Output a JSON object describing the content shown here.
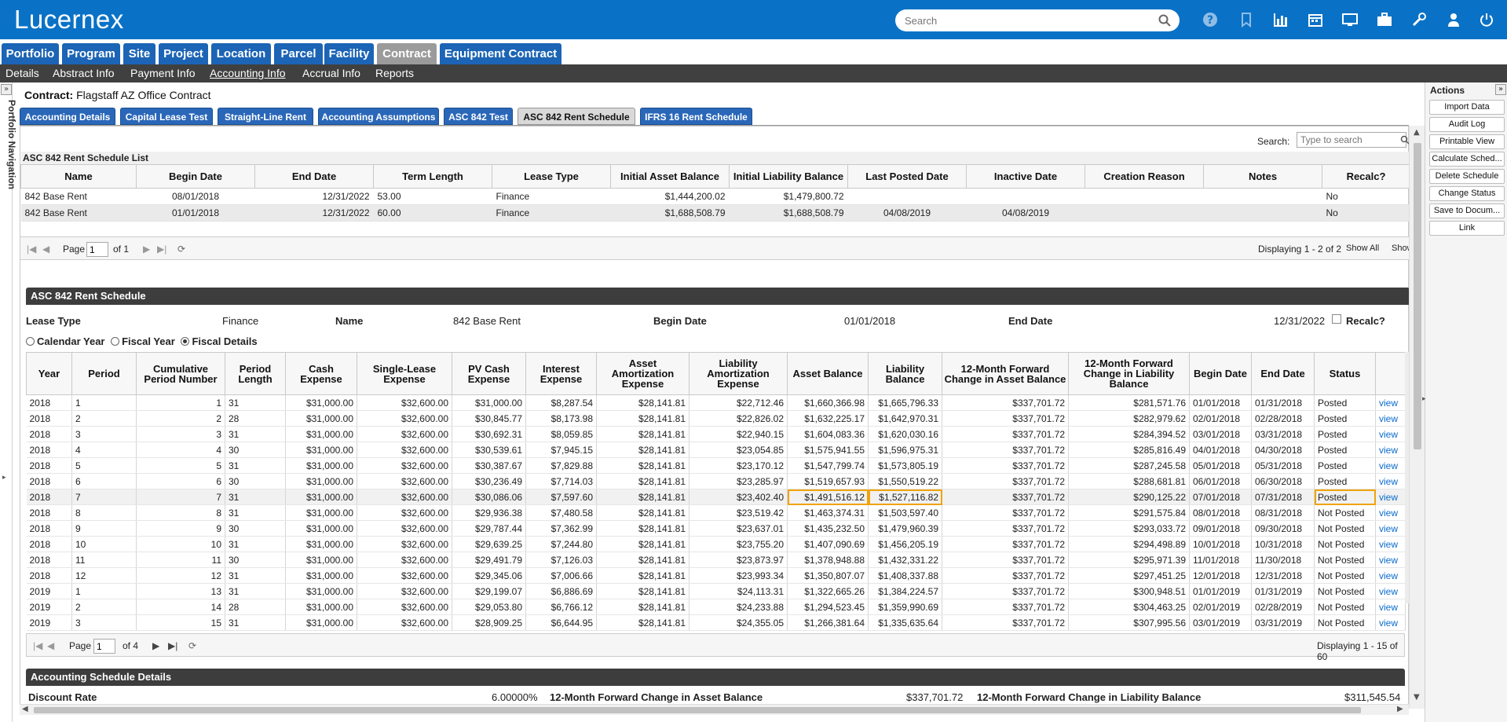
{
  "app": {
    "logo": "Lucernex"
  },
  "header": {
    "search_placeholder": "Search",
    "icons": [
      "search-icon",
      "help-icon",
      "bookmark-icon",
      "chart-icon",
      "calendar-icon",
      "monitor-icon",
      "briefcase-icon",
      "wrench-icon",
      "user-icon",
      "power-icon"
    ]
  },
  "main_tabs": [
    {
      "label": "Portfolio"
    },
    {
      "label": "Program"
    },
    {
      "label": "Site"
    },
    {
      "label": "Project"
    },
    {
      "label": "Location"
    },
    {
      "label": "Parcel"
    },
    {
      "label": "Facility"
    },
    {
      "label": "Contract"
    },
    {
      "label": "Equipment Contract"
    }
  ],
  "sub_nav": [
    {
      "label": "Details"
    },
    {
      "label": "Abstract Info"
    },
    {
      "label": "Payment Info"
    },
    {
      "label": "Accounting Info"
    },
    {
      "label": "Accrual Info"
    },
    {
      "label": "Reports"
    }
  ],
  "left_nav": {
    "label": "Portfolio Navigation",
    "toggle": "»"
  },
  "actions": {
    "title": "Actions",
    "toggle": "»",
    "buttons": [
      "Import Data",
      "Audit Log",
      "Printable View",
      "Calculate Sched...",
      "Delete Schedule",
      "Change Status",
      "Save to Docum...",
      "Link"
    ]
  },
  "contract": {
    "label": "Contract:",
    "name": "Flagstaff AZ Office Contract"
  },
  "contract_tabs": [
    {
      "label": "Accounting Details"
    },
    {
      "label": "Capital Lease Test"
    },
    {
      "label": "Straight-Line Rent"
    },
    {
      "label": "Accounting Assumptions"
    },
    {
      "label": "ASC 842 Test"
    },
    {
      "label": "ASC 842 Rent Schedule"
    },
    {
      "label": "IFRS 16 Rent Schedule"
    }
  ],
  "list": {
    "search_label": "Search:",
    "search_placeholder": "Type to search",
    "title": "ASC 842 Rent Schedule List",
    "columns": [
      "Name",
      "Begin Date",
      "End Date",
      "Term Length",
      "Lease Type",
      "Initial Asset Balance",
      "Initial Liability Balance",
      "Last Posted Date",
      "Inactive Date",
      "Creation Reason",
      "Notes",
      "Recalc?"
    ],
    "rows": [
      [
        "842 Base Rent",
        "08/01/2018",
        "12/31/2022",
        "53.00",
        "Finance",
        "$1,444,200.02",
        "$1,479,800.72",
        "",
        "",
        "",
        "",
        "No"
      ],
      [
        "842 Base Rent",
        "01/01/2018",
        "12/31/2022",
        "60.00",
        "Finance",
        "$1,688,508.79",
        "$1,688,508.79",
        "04/08/2019",
        "04/08/2019",
        "",
        "",
        "No"
      ]
    ],
    "pager": {
      "page_label": "Page",
      "page_value": "1",
      "of": "of 1",
      "displaying": "Displaying 1 - 2 of 2",
      "show_all": "Show All",
      "show": "Show"
    }
  },
  "schedule": {
    "title": "ASC 842 Rent Schedule",
    "lease_type_label": "Lease Type",
    "lease_type": "Finance",
    "name_label": "Name",
    "name": "842 Base Rent",
    "begin_label": "Begin Date",
    "begin": "01/01/2018",
    "end_label": "End Date",
    "end": "12/31/2022",
    "recalc_label": "Recalc?",
    "radio_calendar": "Calendar Year",
    "radio_fiscal": "Fiscal Year",
    "radio_details": "Fiscal Details",
    "columns": [
      "Year",
      "Period",
      "Cumulative Period Number",
      "Period Length",
      "Cash Expense",
      "Single-Lease Expense",
      "PV Cash Expense",
      "Interest Expense",
      "Asset Amortization Expense",
      "Liability Amortization Expense",
      "Asset Balance",
      "Liability Balance",
      "12-Month Forward Change in Asset Balance",
      "12-Month Forward Change in Liability Balance",
      "Begin Date",
      "End Date",
      "Status",
      ""
    ],
    "rows": [
      [
        "2018",
        "1",
        "1",
        "31",
        "$31,000.00",
        "$32,600.00",
        "$31,000.00",
        "$8,287.54",
        "$28,141.81",
        "$22,712.46",
        "$1,660,366.98",
        "$1,665,796.33",
        "$337,701.72",
        "$281,571.76",
        "01/01/2018",
        "01/31/2018",
        "Posted",
        "view"
      ],
      [
        "2018",
        "2",
        "2",
        "28",
        "$31,000.00",
        "$32,600.00",
        "$30,845.77",
        "$8,173.98",
        "$28,141.81",
        "$22,826.02",
        "$1,632,225.17",
        "$1,642,970.31",
        "$337,701.72",
        "$282,979.62",
        "02/01/2018",
        "02/28/2018",
        "Posted",
        "view"
      ],
      [
        "2018",
        "3",
        "3",
        "31",
        "$31,000.00",
        "$32,600.00",
        "$30,692.31",
        "$8,059.85",
        "$28,141.81",
        "$22,940.15",
        "$1,604,083.36",
        "$1,620,030.16",
        "$337,701.72",
        "$284,394.52",
        "03/01/2018",
        "03/31/2018",
        "Posted",
        "view"
      ],
      [
        "2018",
        "4",
        "4",
        "30",
        "$31,000.00",
        "$32,600.00",
        "$30,539.61",
        "$7,945.15",
        "$28,141.81",
        "$23,054.85",
        "$1,575,941.55",
        "$1,596,975.31",
        "$337,701.72",
        "$285,816.49",
        "04/01/2018",
        "04/30/2018",
        "Posted",
        "view"
      ],
      [
        "2018",
        "5",
        "5",
        "31",
        "$31,000.00",
        "$32,600.00",
        "$30,387.67",
        "$7,829.88",
        "$28,141.81",
        "$23,170.12",
        "$1,547,799.74",
        "$1,573,805.19",
        "$337,701.72",
        "$287,245.58",
        "05/01/2018",
        "05/31/2018",
        "Posted",
        "view"
      ],
      [
        "2018",
        "6",
        "6",
        "30",
        "$31,000.00",
        "$32,600.00",
        "$30,236.49",
        "$7,714.03",
        "$28,141.81",
        "$23,285.97",
        "$1,519,657.93",
        "$1,550,519.22",
        "$337,701.72",
        "$288,681.81",
        "06/01/2018",
        "06/30/2018",
        "Posted",
        "view"
      ],
      [
        "2018",
        "7",
        "7",
        "31",
        "$31,000.00",
        "$32,600.00",
        "$30,086.06",
        "$7,597.60",
        "$28,141.81",
        "$23,402.40",
        "$1,491,516.12",
        "$1,527,116.82",
        "$337,701.72",
        "$290,125.22",
        "07/01/2018",
        "07/31/2018",
        "Posted",
        "view"
      ],
      [
        "2018",
        "8",
        "8",
        "31",
        "$31,000.00",
        "$32,600.00",
        "$29,936.38",
        "$7,480.58",
        "$28,141.81",
        "$23,519.42",
        "$1,463,374.31",
        "$1,503,597.40",
        "$337,701.72",
        "$291,575.84",
        "08/01/2018",
        "08/31/2018",
        "Not Posted",
        "view"
      ],
      [
        "2018",
        "9",
        "9",
        "30",
        "$31,000.00",
        "$32,600.00",
        "$29,787.44",
        "$7,362.99",
        "$28,141.81",
        "$23,637.01",
        "$1,435,232.50",
        "$1,479,960.39",
        "$337,701.72",
        "$293,033.72",
        "09/01/2018",
        "09/30/2018",
        "Not Posted",
        "view"
      ],
      [
        "2018",
        "10",
        "10",
        "31",
        "$31,000.00",
        "$32,600.00",
        "$29,639.25",
        "$7,244.80",
        "$28,141.81",
        "$23,755.20",
        "$1,407,090.69",
        "$1,456,205.19",
        "$337,701.72",
        "$294,498.89",
        "10/01/2018",
        "10/31/2018",
        "Not Posted",
        "view"
      ],
      [
        "2018",
        "11",
        "11",
        "30",
        "$31,000.00",
        "$32,600.00",
        "$29,491.79",
        "$7,126.03",
        "$28,141.81",
        "$23,873.97",
        "$1,378,948.88",
        "$1,432,331.22",
        "$337,701.72",
        "$295,971.39",
        "11/01/2018",
        "11/30/2018",
        "Not Posted",
        "view"
      ],
      [
        "2018",
        "12",
        "12",
        "31",
        "$31,000.00",
        "$32,600.00",
        "$29,345.06",
        "$7,006.66",
        "$28,141.81",
        "$23,993.34",
        "$1,350,807.07",
        "$1,408,337.88",
        "$337,701.72",
        "$297,451.25",
        "12/01/2018",
        "12/31/2018",
        "Not Posted",
        "view"
      ],
      [
        "2019",
        "1",
        "13",
        "31",
        "$31,000.00",
        "$32,600.00",
        "$29,199.07",
        "$6,886.69",
        "$28,141.81",
        "$24,113.31",
        "$1,322,665.26",
        "$1,384,224.57",
        "$337,701.72",
        "$300,948.51",
        "01/01/2019",
        "01/31/2019",
        "Not Posted",
        "view"
      ],
      [
        "2019",
        "2",
        "14",
        "28",
        "$31,000.00",
        "$32,600.00",
        "$29,053.80",
        "$6,766.12",
        "$28,141.81",
        "$24,233.88",
        "$1,294,523.45",
        "$1,359,990.69",
        "$337,701.72",
        "$304,463.25",
        "02/01/2019",
        "02/28/2019",
        "Not Posted",
        "view"
      ],
      [
        "2019",
        "3",
        "15",
        "31",
        "$31,000.00",
        "$32,600.00",
        "$28,909.25",
        "$6,644.95",
        "$28,141.81",
        "$24,355.05",
        "$1,266,381.64",
        "$1,335,635.64",
        "$337,701.72",
        "$307,995.56",
        "03/01/2019",
        "03/31/2019",
        "Not Posted",
        "view"
      ]
    ],
    "pager": {
      "page_label": "Page",
      "page_value": "1",
      "of": "of 4",
      "displaying": "Displaying 1 - 15 of 60"
    }
  },
  "accounting_details": {
    "title": "Accounting Schedule Details",
    "discount_rate_label": "Discount Rate",
    "discount_rate": "6.00000%",
    "asset_change_label": "12-Month Forward Change in Asset Balance",
    "asset_change": "$337,701.72",
    "liability_change_label": "12-Month Forward Change in Liability Balance",
    "liability_change": "$311,545.54"
  },
  "colors": {
    "brand_blue": "#0a72c6",
    "tab_blue": "#1c64b5",
    "status_red": "#c00000",
    "highlight_orange": "#f0a30a"
  }
}
